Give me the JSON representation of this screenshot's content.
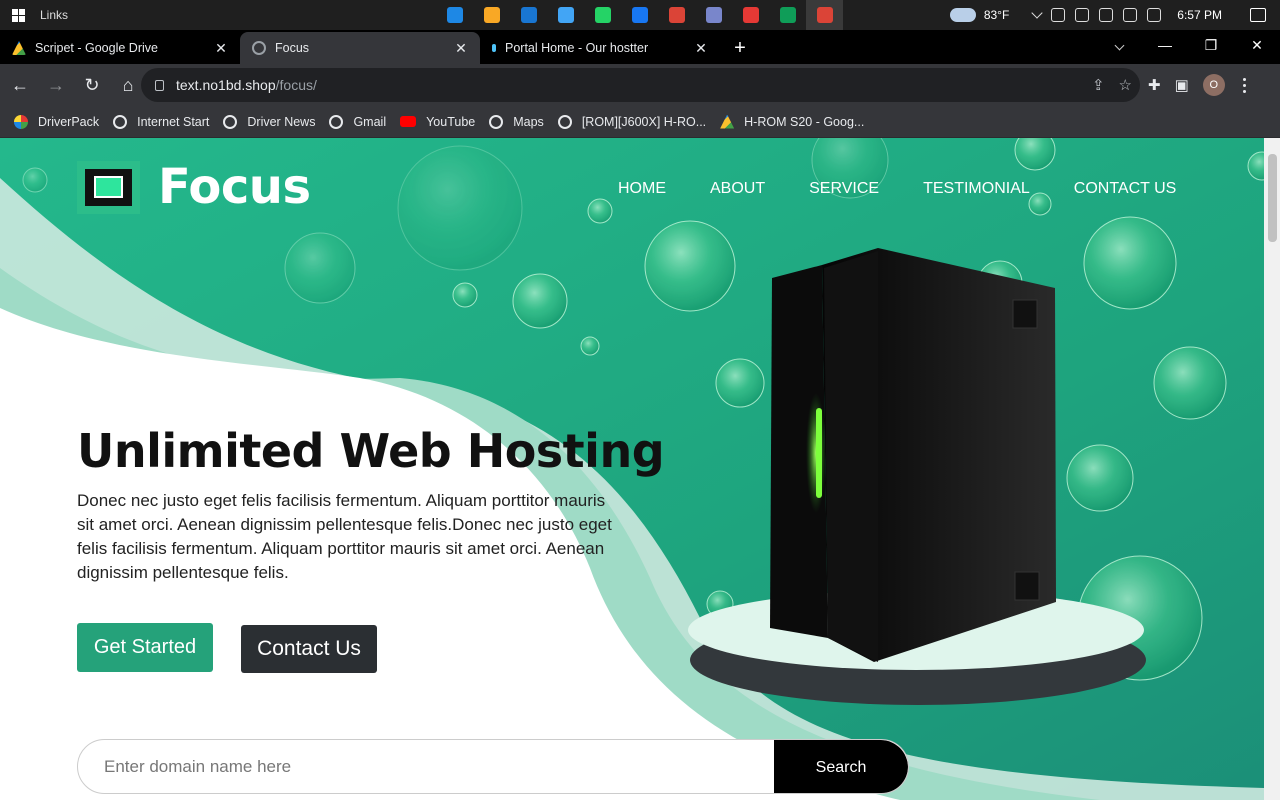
{
  "taskbar": {
    "links_label": "Links",
    "weather": "83°F",
    "time": "6:57 PM",
    "app_colors": [
      "#1e88e5",
      "#f9a825",
      "#1976d2",
      "#42a5f5",
      "#25d366",
      "#1877f2",
      "#db4437",
      "#7986cb",
      "#e53935",
      "#0f9d58",
      "#db4437"
    ]
  },
  "tabs": [
    {
      "title": "Scripet - Google Drive",
      "favicon": "google-drive-icon",
      "color": "#fbc02d"
    },
    {
      "title": "Focus",
      "favicon": "globe-icon",
      "color": "#9aa0a6",
      "active": true
    },
    {
      "title": "Portal Home - Our hostter",
      "favicon": "portal-icon",
      "color": "#4fc3f7"
    }
  ],
  "omnibox": {
    "host": "text.no1bd.shop",
    "path": "/focus/"
  },
  "profile_initial": "O",
  "bookmarks": [
    {
      "label": "DriverPack",
      "icon": "driverpack-icon"
    },
    {
      "label": "Internet Start",
      "icon": "globe-icon"
    },
    {
      "label": "Driver News",
      "icon": "globe-icon"
    },
    {
      "label": "Gmail",
      "icon": "globe-icon"
    },
    {
      "label": "YouTube",
      "icon": "youtube-icon"
    },
    {
      "label": "Maps",
      "icon": "globe-icon"
    },
    {
      "label": "[ROM][J600X] H-RO...",
      "icon": "globe-icon"
    },
    {
      "label": "H-ROM S20 - Goog...",
      "icon": "google-drive-icon"
    }
  ],
  "site": {
    "logo_text": "Focus",
    "nav": [
      "HOME",
      "ABOUT",
      "SERVICE",
      "TESTIMONIAL",
      "CONTACT US"
    ],
    "hero_title": "Unlimited Web Hosting",
    "hero_text": "Donec nec justo eget felis facilisis fermentum. Aliquam porttitor mauris sit amet orci. Aenean dignissim pellentesque felis.Donec nec justo eget felis facilisis fermentum. Aliquam porttitor mauris sit amet orci. Aenean dignissim pellentesque felis.",
    "btn_start": "Get Started",
    "btn_contact": "Contact Us",
    "search_placeholder": "Enter domain name here",
    "search_button": "Search",
    "colors": {
      "brand": "#25a27a",
      "teal_bg": "#1fae84",
      "dark_button": "#2b2f33"
    }
  }
}
